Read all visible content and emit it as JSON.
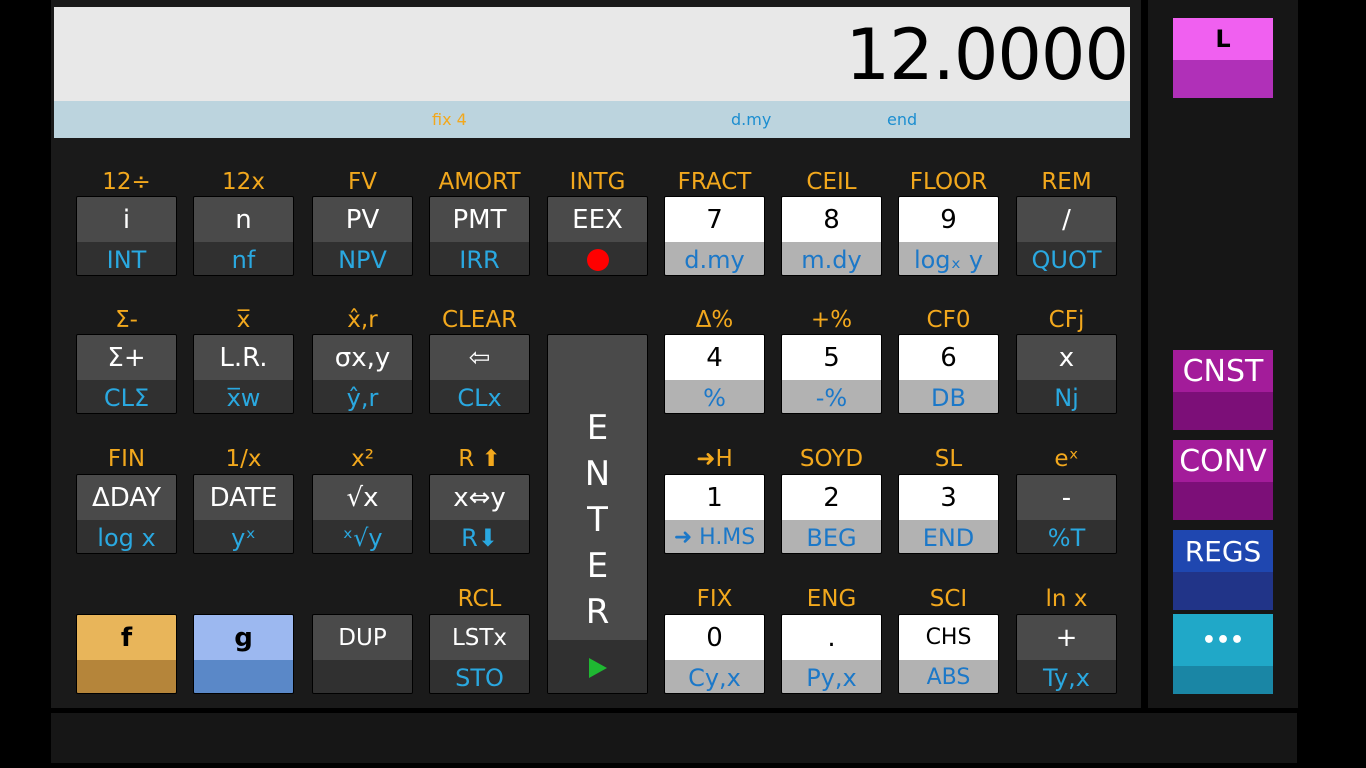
{
  "display": {
    "value": "12.0000",
    "status": {
      "fix": "fix 4",
      "date": "d.my",
      "mode": "end"
    }
  },
  "colors": {
    "orange_label": "#f2a81d",
    "blue_label": "#2aa8e0",
    "f_key": "#e8b55a",
    "g_key": "#9cb8f0",
    "cnst": "#a31c9a",
    "regs": "#1f47b0",
    "more": "#20a8c8"
  },
  "keys": {
    "r1": [
      {
        "f": "12÷",
        "main": "i",
        "g": "INT"
      },
      {
        "f": "12x",
        "main": "n",
        "g": "nf"
      },
      {
        "f": "FV",
        "main": "PV",
        "g": "NPV"
      },
      {
        "f": "AMORT",
        "main": "PMT",
        "g": "IRR"
      },
      {
        "f": "INTG",
        "main": "EEX",
        "g_icon": "red-dot-icon"
      },
      {
        "f": "FRACT",
        "main": "7",
        "g": "d.my"
      },
      {
        "f": "CEIL",
        "main": "8",
        "g": "m.dy"
      },
      {
        "f": "FLOOR",
        "main": "9",
        "g": "logₓ y"
      },
      {
        "f": "REM",
        "main": "/",
        "g": "QUOT"
      }
    ],
    "r2": [
      {
        "f": "Σ-",
        "main": "Σ+",
        "g": "CLΣ"
      },
      {
        "f": "x̅",
        "main": "L.R.",
        "g": "x̅w"
      },
      {
        "f": "x̂,r",
        "main": "σx,y",
        "g": "ŷ,r"
      },
      {
        "f": "CLEAR",
        "main": "⇦",
        "g": "CLx"
      },
      {
        "f": "Δ%",
        "main": "4",
        "g": "%"
      },
      {
        "f": "+%",
        "main": "5",
        "g": "-%"
      },
      {
        "f": "CF0",
        "main": "6",
        "g": "DB"
      },
      {
        "f": "CFj",
        "main": "x",
        "g": "Nj"
      }
    ],
    "r3": [
      {
        "f": "FIN",
        "main": "ΔDAY",
        "g": "log x"
      },
      {
        "f": "1/x",
        "main": "DATE",
        "g": "yˣ"
      },
      {
        "f": "x²",
        "main": "√x",
        "g": "ˣ√y"
      },
      {
        "f": "R",
        "main": "x⇔y",
        "g": "R"
      },
      {
        "f": "➜H",
        "main": "1",
        "g": "➜ H.MS"
      },
      {
        "f": "SOYD",
        "main": "2",
        "g": "BEG"
      },
      {
        "f": "SL",
        "main": "3",
        "g": "END"
      },
      {
        "f": "eˣ",
        "main": "-",
        "g": "%T"
      }
    ],
    "r4": [
      {
        "main": "f"
      },
      {
        "main": "g"
      },
      {
        "main": "DUP",
        "g": ""
      },
      {
        "f": "RCL",
        "main": "LSTx",
        "g": "STO"
      },
      {
        "f": "FIX",
        "main": "0",
        "g": "Cy,x"
      },
      {
        "f": "ENG",
        "main": ".",
        "g": "Py,x"
      },
      {
        "f": "SCI",
        "main": "CHS",
        "g": "ABS"
      },
      {
        "f": "ln x",
        "main": "+",
        "g": "Ty,x"
      }
    ],
    "enter": {
      "label": "ENTER",
      "icon": "play-icon"
    }
  },
  "side": {
    "l": "L",
    "cnst": "CNST",
    "conv": "CONV",
    "regs": "REGS",
    "more": "•••"
  }
}
